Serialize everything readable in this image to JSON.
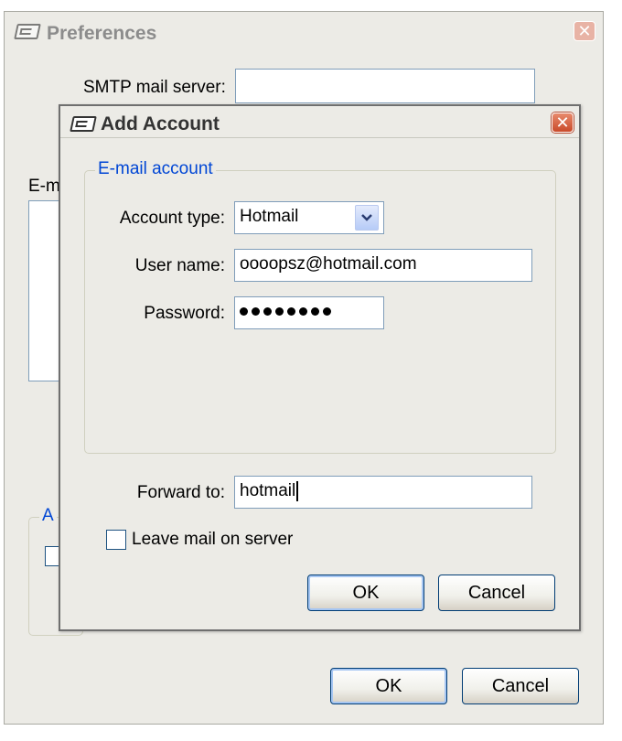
{
  "preferences": {
    "title": "Preferences",
    "smtp_label": "SMTP mail server:",
    "smtp_value": "",
    "email_label_partial": "E-m",
    "accounts_group_partial": "A",
    "ok_label": "OK",
    "cancel_label": "Cancel"
  },
  "add_account": {
    "title": "Add Account",
    "group_title": "E-mail account",
    "account_type_label": "Account type:",
    "account_type_value": "Hotmail",
    "username_label": "User name:",
    "username_value": "oooopsz@hotmail.com",
    "password_label": "Password:",
    "password_dots": 8,
    "forward_label": "Forward to:",
    "forward_value": "hotmail",
    "leave_mail_label": "Leave mail on server",
    "leave_mail_checked": false,
    "ok_label": "OK",
    "cancel_label": "Cancel"
  },
  "icons": {
    "app": "app-window-icon",
    "close": "close-icon",
    "dropdown": "chevron-down-icon"
  },
  "colors": {
    "dialog_bg": "#ecebe6",
    "group_legend": "#0046d5",
    "inactive_title": "#8c8c8c",
    "active_title": "#333333",
    "close_inactive": "#e8b3a5",
    "close_active": "#c94a2a"
  }
}
